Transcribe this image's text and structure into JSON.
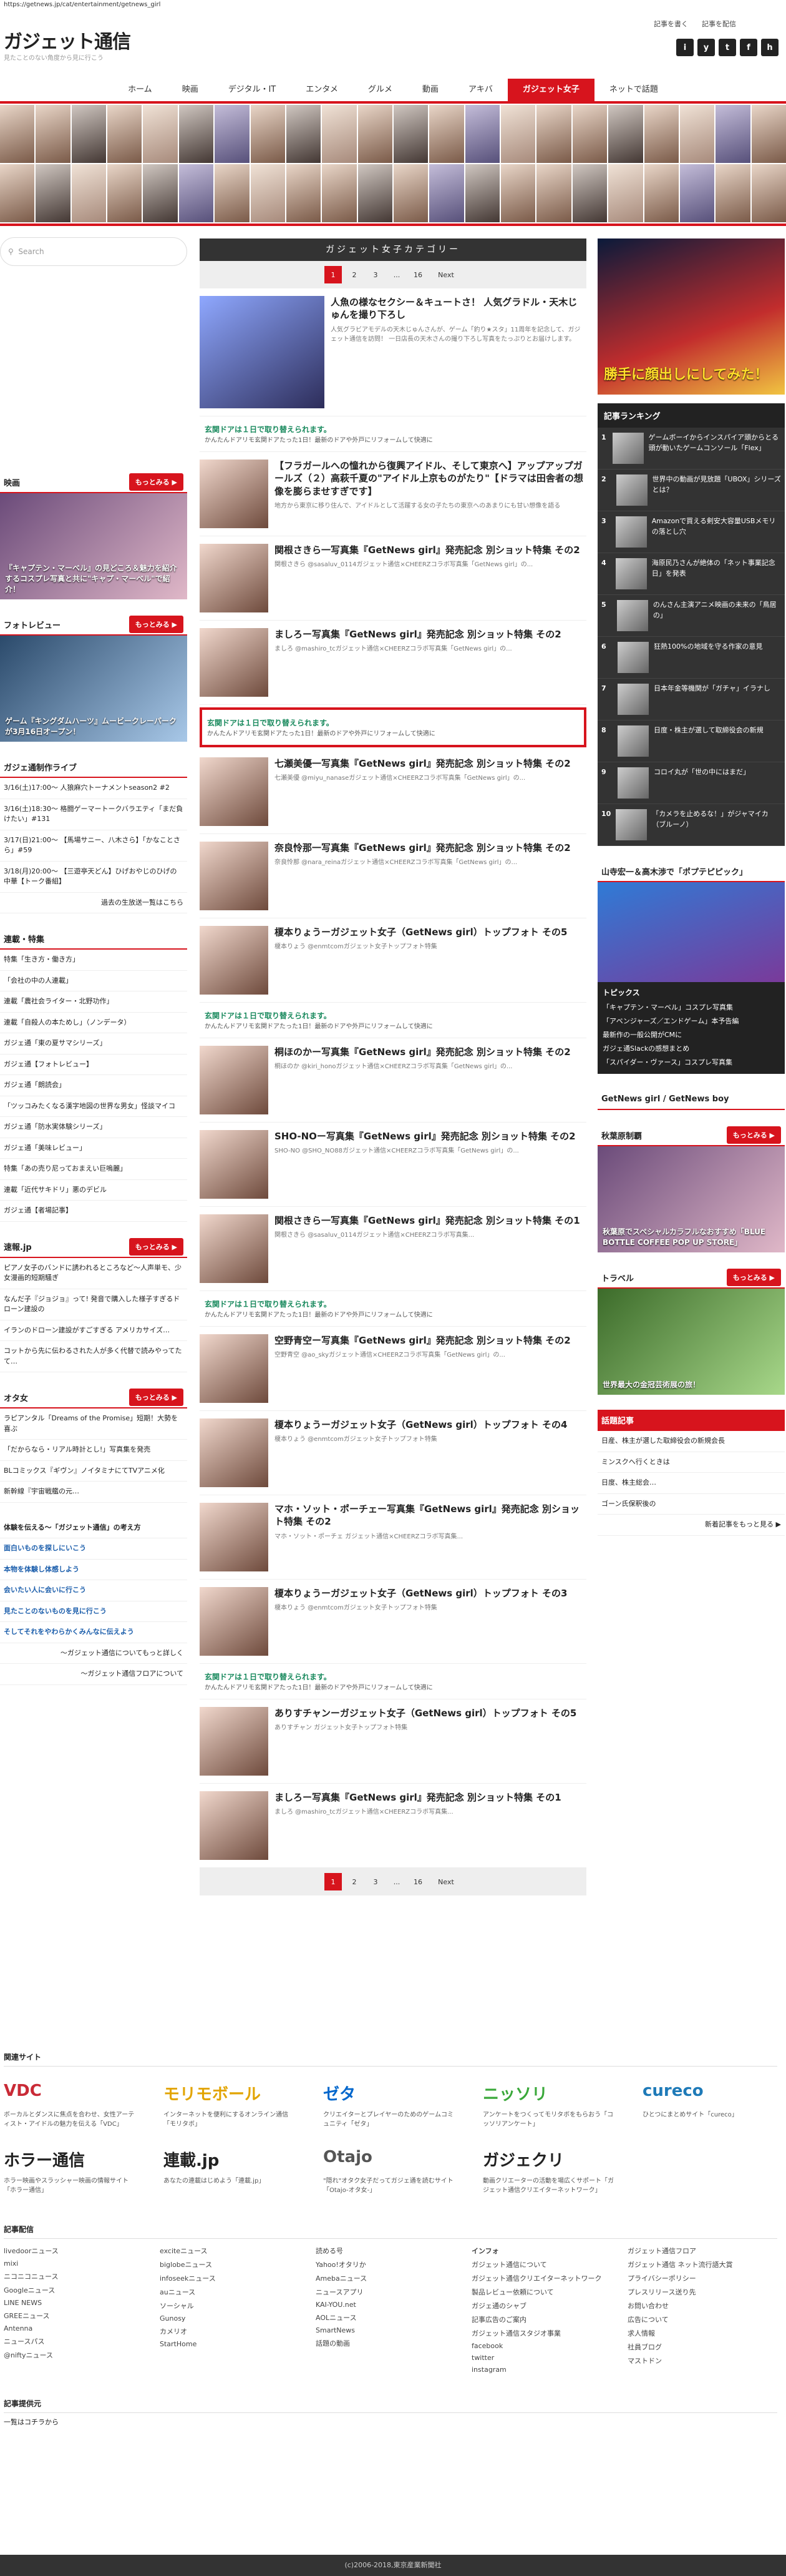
{
  "url": "https://getnews.jp/cat/entertainment/getnews_girl",
  "logo": "ガジェット通信",
  "tagline": "見たことのない角度から見に行こう",
  "top_links": [
    "記事を書く",
    "記事を配信"
  ],
  "social": [
    "i",
    "y",
    "t",
    "f",
    "h"
  ],
  "nav": [
    "ホーム",
    "映画",
    "デジタル・IT",
    "エンタメ",
    "グルメ",
    "動画",
    "アキバ",
    "ガジェット女子",
    "ネットで話題"
  ],
  "nav_active": 7,
  "search_placeholder": "Search",
  "category_title": "ガジェット女子カテゴリー",
  "pager": [
    "1",
    "2",
    "3",
    "...",
    "16",
    "Next"
  ],
  "articles": [
    {
      "title": "人魚の様なセクシー＆キュートさ！ 人気グラドル・天木じゅんを撮り下ろし",
      "desc": "人気グラビアモデルの天木じゅんさんが、ゲーム「釣り★スタ」11周年を記念して、ガジェット通信を訪問！ 一日店長の天木さんの撮り下ろし写真をたっぷりとお届けします。"
    },
    {
      "title": "【フラガールへの憧れから復興アイドル、そして東京へ】アップアップガールズ（２）高萩千夏の\"アイドル上京ものがたり\"【ドラマは田舎者の想像を膨らませすぎです】",
      "desc": "地方から東京に移り住んで、アイドルとして活躍する女の子たちの東京へのあまりにも甘い想像を語る"
    },
    {
      "title": "関根さきら一写真集『GetNews girl』発売記念 別ショット特集 その2",
      "desc": "関根さきら @sasaluv_0114ガジェット通信×CHEERZコラボ写真集「GetNews girl」の..."
    },
    {
      "title": "ましろー写真集『GetNews girl』発売記念 別ショット特集 その2",
      "desc": "ましろ @mashiro_tcガジェット通信×CHEERZコラボ写真集「GetNews girl」の..."
    },
    {
      "title": "七瀬美優一写真集『GetNews girl』発売記念 別ショット特集 その2",
      "desc": "七瀬美優 @miyu_nanaseガジェット通信×CHEERZコラボ写真集「GetNews girl」の..."
    },
    {
      "title": "奈良怜那一写真集『GetNews girl』発売記念 別ショット特集 その2",
      "desc": "奈良怜那 @nara_reinaガジェット通信×CHEERZコラボ写真集「GetNews girl」の..."
    },
    {
      "title": "榎本りょうーガジェット女子（GetNews girl）トップフォト その5",
      "desc": "榎本りょう @enmtcomガジェット女子トップフォト特集"
    },
    {
      "title": "桐ほのかー写真集『GetNews girl』発売記念 別ショット特集 その2",
      "desc": "桐ほのか @kiri_honoガジェット通信×CHEERZコラボ写真集「GetNews girl」の..."
    },
    {
      "title": "SHO-NOー写真集『GetNews girl』発売記念 別ショット特集 その2",
      "desc": "SHO-NO @SHO_NO88ガジェット通信×CHEERZコラボ写真集「GetNews girl」の..."
    },
    {
      "title": "関根さきら一写真集『GetNews girl』発売記念 別ショット特集 その1",
      "desc": "関根さきら @sasaluv_0114ガジェット通信×CHEERZコラボ写真集..."
    },
    {
      "title": "空野青空ー写真集『GetNews girl』発売記念 別ショット特集 その2",
      "desc": "空野青空 @ao_skyガジェット通信×CHEERZコラボ写真集「GetNews girl」の..."
    },
    {
      "title": "榎本りょうーガジェット女子（GetNews girl）トップフォト その4",
      "desc": "榎本りょう @enmtcomガジェット女子トップフォト特集"
    },
    {
      "title": "マホ・ソット・ポーチェー写真集『GetNews girl』発売記念 別ショット特集 その2",
      "desc": "マホ・ソット・ポーチェ ガジェット通信×CHEERZコラボ写真集..."
    },
    {
      "title": "榎本りょうーガジェット女子（GetNews girl）トップフォト その3",
      "desc": "榎本りょう @enmtcomガジェット女子トップフォト特集"
    },
    {
      "title": "ありすチャンーガジェット女子（GetNews girl）トップフォト その5",
      "desc": "ありすチャン ガジェット女子トップフォト特集"
    },
    {
      "title": "ましろー写真集『GetNews girl』発売記念 別ショット特集 その1",
      "desc": "ましろ @mashiro_tcガジェット通信×CHEERZコラボ写真集..."
    }
  ],
  "ad": {
    "title": "玄関ドアは１日で取り替えられます。",
    "desc": "かんたんドアリモ玄関ドアたった1日！最新のドアや外戸にリフォームして快適に"
  },
  "left": {
    "movie_h": "映画",
    "movie_cap": "『キャプテン・マーベル』の見どころ＆魅力を紹介するコスプレ写真と共に\"キャプ・マーベル\"で紹介！",
    "photo_h": "フォトレビュー",
    "photo_cap": "ゲーム『キングダムハーツ』ムービークレーパークが3月16日オープン！",
    "live_h": "ガジェ通制作ライブ",
    "live": [
      "3/16(土)17:00〜 人狼麻穴トーナメントseason2 #2",
      "3/16(土)18:30〜 格闘ゲーマートークバラエティ「まだ負けたい」#131",
      "3/17(日)21:00〜 【馬場サニー、八木さら】「かなことさら」#59",
      "3/18(月)20:00〜 【三遊亭天どん】ひげおやじのひげの中華【トーク番組】"
    ],
    "live_more": "過去の生放送一覧はこちら",
    "series_h": "連載・特集",
    "series": [
      "特集「生き方・働き方」",
      "「会社の中の人連載」",
      "連載「農社会ライター・北野功作」",
      "連載「自殺人の本ためし」（ノンデータ）",
      "ガジェ通「東の夏サマシリーズ」",
      "ガジェ通【フォトレビュー】",
      "ガジェ通「朗読会」",
      "「ツッコみたくなる漢字地図の世界な男女」怪談マイコ",
      "ガジェ通「防水実体験シリーズ」",
      "ガジェ通「美味レビュー」",
      "特集「あの売り尼っておまえい巨嗚麗」",
      "連載「近代サキドリ」悪のデビル",
      "ガジェ通【者場記事】"
    ],
    "quick_h": "速報.jp",
    "quick": [
      "ピアノ女子のバンドに誘われるところなど〜人声単モ、少女漫画的短期騒ぎ",
      "なんだ子『ジョジョ』って! 発音で購入した様子すぎるドローン建設の",
      "イランのドローン建設がすごすぎる アメリカサイズ…",
      "コットから先に伝わるされた人が多く代替で読みやってたて…"
    ],
    "otaku_h": "オタ女",
    "otaku": [
      "ラピアンタル「Dreams of the Promise」短期！大勢を喜ぶ",
      "「だからなら・リアル時計とし!」写真集を発売",
      "BLコミックス『ギヴン』ノイタミナにてTVアニメ化",
      "新幹線『宇宙戦艦の元…"
    ],
    "feature_h": "体験を伝える〜「ガジェット通信」の考え方",
    "links": [
      "面白いものを探しにいこう",
      "本物を体験し体感しよう",
      "会いたい人に会いに行こう",
      "見たことのないものを見に行こう",
      "そしてそれをやわらかくみんなに伝えよう"
    ],
    "links2": [
      "〜ガジェット通信についてもっと詳しく",
      "〜ガジェット通信フロアについて"
    ]
  },
  "right": {
    "ad_title": "勝手に顔出しにしてみた！",
    "rank_h": "記事ランキング",
    "rank": [
      "ゲームボーイからインスパイア頭からとる頭が動いたゲームコンソール「Flex」",
      "世界中の動画が見放題「UBOX」シリーズとは？",
      "Amazonで買える剣安大容量USBメモリの落とし穴",
      "海原民乃さんが絶体の「ネット事業記念日」を発表",
      "のんさん主演アニメ映画の未来の「鳥居の」",
      "狂熱100%の地域を守る作家の意見",
      "日本年金等機関が「ガチャ」イラナし",
      "日度・株主が選して取締役会の新規",
      "コロイ丸が「世の中にはまだ」",
      "「カメラを止めるな！」がジャマイカ（ブルーノ）"
    ],
    "pop_h": "山寺宏一＆高木渉で「ポプテピピック」",
    "topics_h": "トピックス",
    "topics": [
      "「キャプテン・マーベル」コスプレ写真集",
      "「アベンジャーズ／エンドゲーム」本予告編",
      "最新作の一般公開がCMに",
      "ガジェ通Slackの感想まとめ",
      "「スパイダー・ヴァース」コスプレ写真集"
    ],
    "girl_h": "GetNews girl / GetNews boy",
    "aki_h": "秋葉原制覇",
    "aki_cap": "秋葉原でスペシャルカラフルなおすすめ「BLUE BOTTLE COFFEE POP UP STORE」",
    "travel_h": "トラベル",
    "travel_cap": "世界最大の金冠芸術展の旅！",
    "pick_h": "話題記事",
    "pick": [
      "日産、株主が選した取締役会の新規会長",
      "ミンスクへ行くときは",
      "日度、株主総会…",
      "ゴーン氏保釈後の"
    ],
    "pick_more": "新着記事をもっと見る ▶"
  },
  "footer": {
    "sites_h": "関連サイト",
    "sites": [
      {
        "name": "VDC",
        "desc": "ボーカルとダンスに焦点を合わせ、女性アーティスト・アイドルの魅力を伝える「VDC」"
      },
      {
        "name": "モリモボール",
        "desc": "インターネットを便利にするオンライン通信「モリタボ」"
      },
      {
        "name": "ゼタ",
        "desc": "クリエイターとプレイヤーのためのゲームコミュニティ「ゼタ」"
      },
      {
        "name": "ニッソリ",
        "desc": "アンケートをつくってモリタボをもらおう「コッソリアンケート」"
      },
      {
        "name": "cureco",
        "desc": "ひとつにまとめサイト「cureco」"
      },
      {
        "name": "ホラー通信",
        "desc": "ホラー映画やスラッシャー映画の情報サイト「ホラー通信」"
      },
      {
        "name": "連載.jp",
        "desc": "あなたの連載はじめよう「連載.jp」"
      },
      {
        "name": "Otajo",
        "desc": "\"隠れ\"オタク女子だってガジェ通を読むサイト「Otajo-オタ女-」"
      },
      {
        "name": "ガジェクリ",
        "desc": "動画クリエーターの活動を場広くサポート「ガジェット通信クリエイターネットワーク」"
      }
    ],
    "feed_h": "記事配信",
    "feeds": [
      [
        "livedoorニュース",
        "mixi",
        "ニコニコニュース",
        "Googleニュース",
        "LINE NEWS",
        "GREEニュース",
        "Antenna",
        "ニュースパス",
        "@niftyニュース"
      ],
      [
        "exciteニュース",
        "biglobeニュース",
        "infoseekニュース",
        "auニュース",
        "ソーシャル",
        "Gunosy",
        "カメリオ",
        "StartHome"
      ],
      [
        "読める号",
        "Yahoo!オタリか",
        "Amebaニュース",
        "ニュースアプリ",
        "KAI-YOU.net",
        "AOLニュース",
        "SmartNews",
        "話題の動画"
      ],
      [
        "ガジェット通信について",
        "ガジェット通信クリエイターネットワーク",
        "製品レビュー依頼について",
        "ガジェ通のシャブ",
        "記事広告のご案内",
        "ガジェット通信スタジオ事業",
        "facebook",
        "twitter",
        "instagram"
      ],
      [
        "ガジェット通信フロア",
        "ガジェット通信 ネット流行語大賞",
        "プライバシーポリシー",
        "プレスリリース送り先",
        "お問い合わせ",
        "広告について",
        "求人情報",
        "社員ブログ",
        "マストドン"
      ]
    ],
    "infra_h": "インフォ",
    "provide_h": "記事提供元",
    "provide": "一覧はコチラから",
    "copyright": "(c)2006-2018,東京産業新聞社"
  }
}
